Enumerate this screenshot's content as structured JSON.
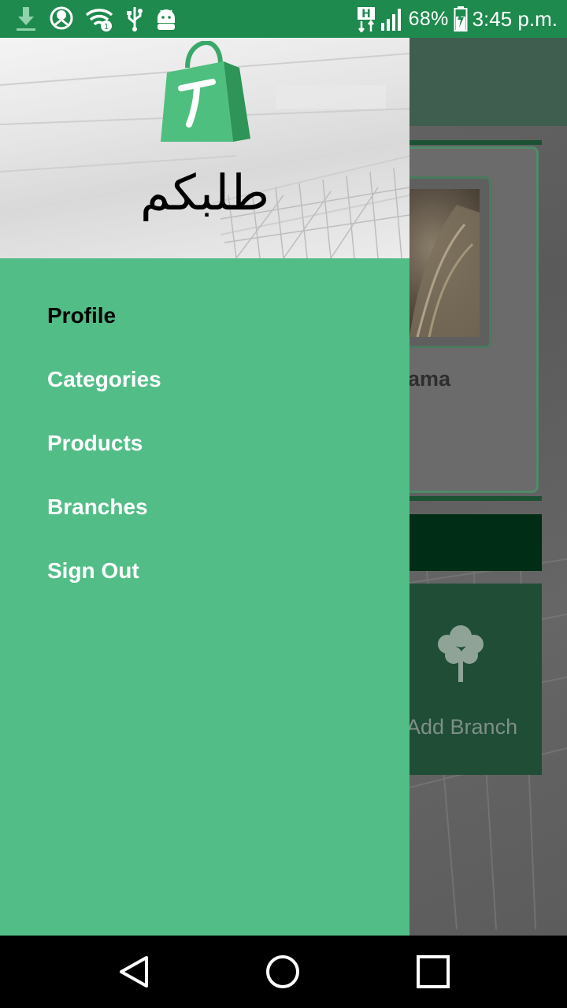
{
  "status_bar": {
    "battery": "68%",
    "time": "3:45 p.m.",
    "network_badge": "H"
  },
  "app": {
    "logo_text": "طلبكم",
    "logo_letter": "T"
  },
  "drawer": {
    "menu_items": [
      {
        "label": "Profile",
        "active": true
      },
      {
        "label": "Categories",
        "active": false
      },
      {
        "label": "Products",
        "active": false
      },
      {
        "label": "Branches",
        "active": false
      },
      {
        "label": "Sign Out",
        "active": false
      }
    ]
  },
  "background": {
    "card_title": "ama",
    "add_branch_label": "Add Branch"
  },
  "colors": {
    "status_bar": "#1e8a4e",
    "drawer": "#52bd87",
    "active_item": "#000000",
    "item": "#ffffff"
  },
  "icons": {
    "status_left": [
      "download-icon",
      "location-icon",
      "wifi-icon",
      "usb-icon",
      "android-debug-icon"
    ],
    "status_right": [
      "network-h-icon",
      "signal-icon",
      "battery-charging-icon"
    ],
    "nav": [
      "back-icon",
      "home-icon",
      "recents-icon"
    ]
  }
}
